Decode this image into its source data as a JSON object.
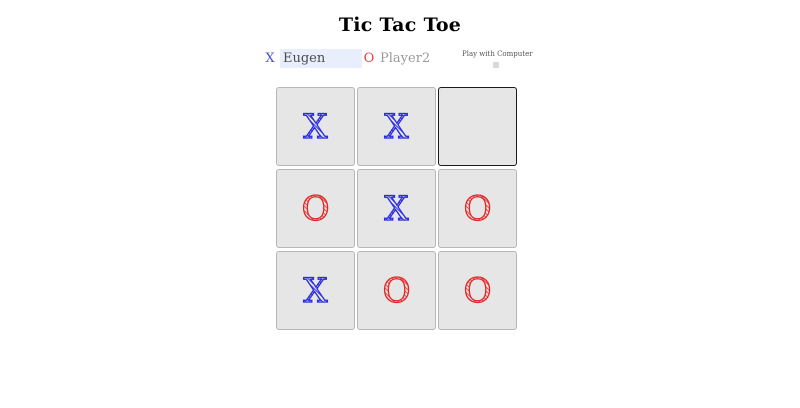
{
  "title": "Tic Tac Toe",
  "player1": {
    "symbol": "X",
    "name": "Eugen"
  },
  "player2": {
    "symbol": "O",
    "placeholder": "Player2"
  },
  "computer_toggle": {
    "label": "Play with Computer",
    "checked": false
  },
  "board": [
    {
      "value": "X"
    },
    {
      "value": "X"
    },
    {
      "value": ""
    },
    {
      "value": "O"
    },
    {
      "value": "X"
    },
    {
      "value": "O"
    },
    {
      "value": "X"
    },
    {
      "value": "O"
    },
    {
      "value": "O"
    }
  ],
  "focused_cell": 2,
  "colors": {
    "x": "#2b2be0",
    "o": "#e02828",
    "cell_bg": "#e6e6e6",
    "input_bg": "#e8eefc"
  }
}
